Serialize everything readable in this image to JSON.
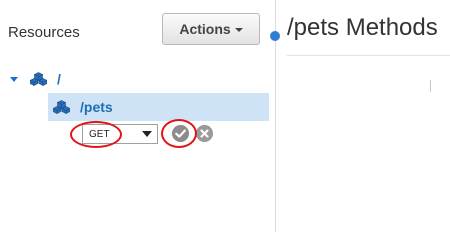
{
  "sidebar": {
    "title": "Resources",
    "actions_label": "Actions",
    "tree": {
      "root_label": "/",
      "child_label": "/pets"
    }
  },
  "method_select": {
    "selected": "GET"
  },
  "main": {
    "title": "/pets Methods"
  },
  "colors": {
    "link_blue": "#1a6fb5",
    "selection_bg": "#cfe3f7",
    "annotation_red": "#e01515",
    "divider_dot": "#2f7fd1"
  },
  "icons": {
    "resource": "resource-icon",
    "confirm": "check-icon",
    "cancel": "x-icon"
  }
}
